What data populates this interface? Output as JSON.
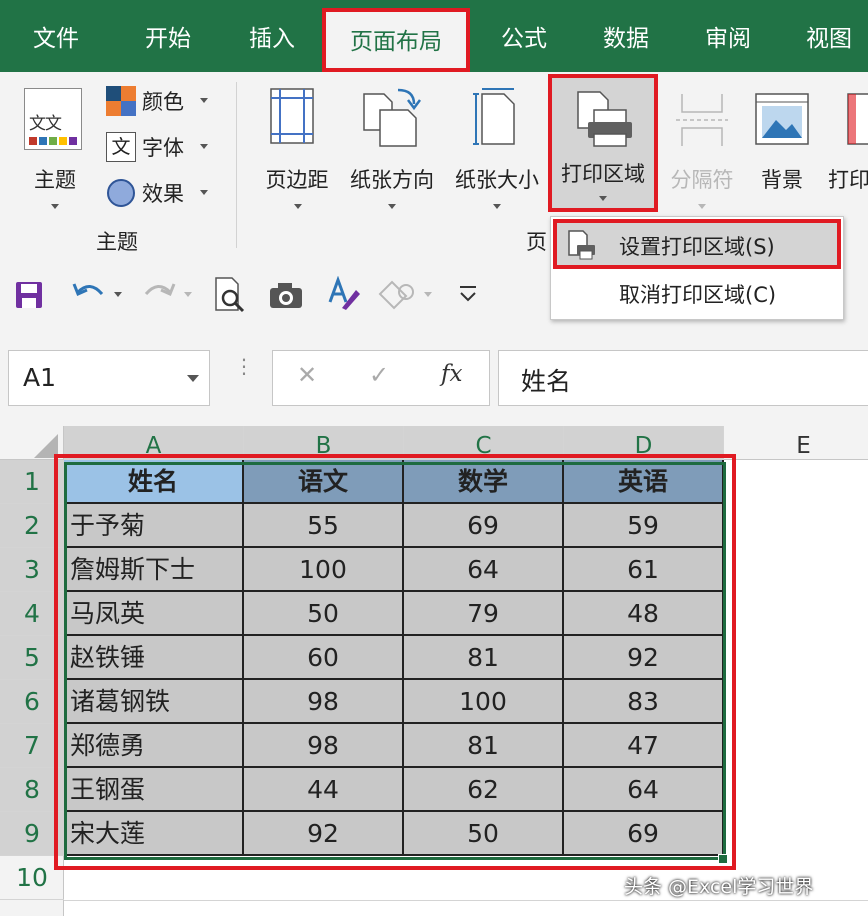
{
  "tabs": [
    {
      "label": "文件"
    },
    {
      "label": "开始"
    },
    {
      "label": "插入"
    },
    {
      "label": "页面布局"
    },
    {
      "label": "公式"
    },
    {
      "label": "数据"
    },
    {
      "label": "审阅"
    },
    {
      "label": "视图"
    }
  ],
  "ribbon": {
    "themes": {
      "label": "主题",
      "colors": "颜色",
      "fonts": "字体",
      "effects": "效果",
      "group_label": "主题",
      "icon_text": "文文"
    },
    "margins": "页边距",
    "orientation": "纸张方向",
    "size": "纸张大小",
    "print_area": "打印区域",
    "breaks": "分隔符",
    "background": "背景",
    "print_titles_partial": "打印",
    "page_setup_group_partial": "页"
  },
  "menu": {
    "set_print_area": "设置打印区域(S)",
    "clear_print_area": "取消打印区域(C)"
  },
  "formula_bar": {
    "name_box": "A1",
    "cancel": "✕",
    "enter": "✓",
    "fx": "fx",
    "content": "姓名"
  },
  "columns": [
    "A",
    "B",
    "C",
    "D",
    "E"
  ],
  "rows": [
    "1",
    "2",
    "3",
    "4",
    "5",
    "6",
    "7",
    "8",
    "9",
    "10"
  ],
  "table": {
    "headers": [
      "姓名",
      "语文",
      "数学",
      "英语"
    ],
    "data": [
      [
        "于予菊",
        "55",
        "69",
        "59"
      ],
      [
        "詹姆斯下士",
        "100",
        "64",
        "61"
      ],
      [
        "马凤英",
        "50",
        "79",
        "48"
      ],
      [
        "赵铁锤",
        "60",
        "81",
        "92"
      ],
      [
        "诸葛钢铁",
        "98",
        "100",
        "83"
      ],
      [
        "郑德勇",
        "98",
        "81",
        "47"
      ],
      [
        "王钢蛋",
        "44",
        "62",
        "64"
      ],
      [
        "宋大莲",
        "92",
        "50",
        "69"
      ]
    ]
  },
  "watermark": "头条 @Excel学习世界",
  "colors": {
    "excel_green": "#217346",
    "highlight_red": "#e01a22",
    "header_blue": "#9bc2e6",
    "header_gray_blue": "#7f9cb9",
    "cell_gray": "#c8c8c8"
  }
}
